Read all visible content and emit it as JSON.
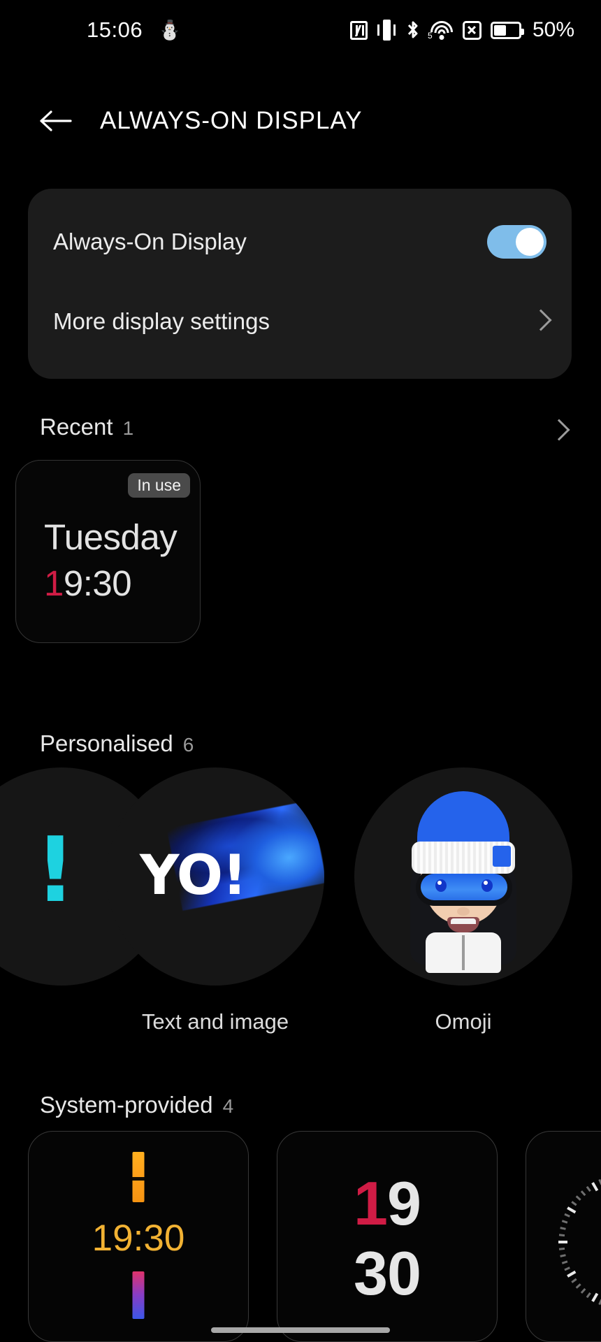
{
  "statusbar": {
    "time": "15:06",
    "gmail_icon": "gmail-icon",
    "nfc_icon": "nfc-icon",
    "vibrate_icon": "vibrate-icon",
    "bluetooth_icon": "bluetooth-icon",
    "wifi_icon": "wifi-5g-icon",
    "signal_off_icon": "signal-off-icon",
    "battery_icon": "battery-icon",
    "battery_percent": "50%"
  },
  "header": {
    "back_icon": "back-arrow-icon",
    "title": "ALWAYS-ON DISPLAY"
  },
  "settings_card": {
    "rows": [
      {
        "label": "Always-On Display",
        "control": "toggle",
        "enabled": true
      },
      {
        "label": "More display settings",
        "control": "chevron"
      }
    ]
  },
  "recent": {
    "title": "Recent",
    "count": "1",
    "chevron_icon": "chevron-right-icon",
    "tile": {
      "badge": "In use",
      "day": "Tuesday",
      "time_accent": "1",
      "time_rest": "9:30"
    }
  },
  "personalised": {
    "title": "Personalised",
    "count": "6",
    "items": [
      {
        "label": "",
        "style": "cyan-exclamation"
      },
      {
        "label": "Text and image",
        "text": "YO!",
        "style": "text-and-image"
      },
      {
        "label": "Omoji",
        "style": "omoji-avatar"
      }
    ]
  },
  "system_provided": {
    "title": "System-provided",
    "count": "4",
    "items": [
      {
        "style": "bars-clock",
        "time": "19:30"
      },
      {
        "style": "stacked-digits",
        "hour_accent": "1",
        "hour_rest": "9",
        "minute": "30"
      },
      {
        "style": "analog-clock"
      }
    ]
  },
  "colors": {
    "background": "#000000",
    "card": "#1c1c1c",
    "toggle_on": "#7FBDEA",
    "accent_red": "#d01c45",
    "accent_gold": "#f2b233",
    "accent_cyan": "#1ED2E0",
    "accent_blue": "#2563eb",
    "muted_text": "#9a9a9a"
  },
  "navbar": {
    "gesture_bar": "gesture-bar"
  }
}
